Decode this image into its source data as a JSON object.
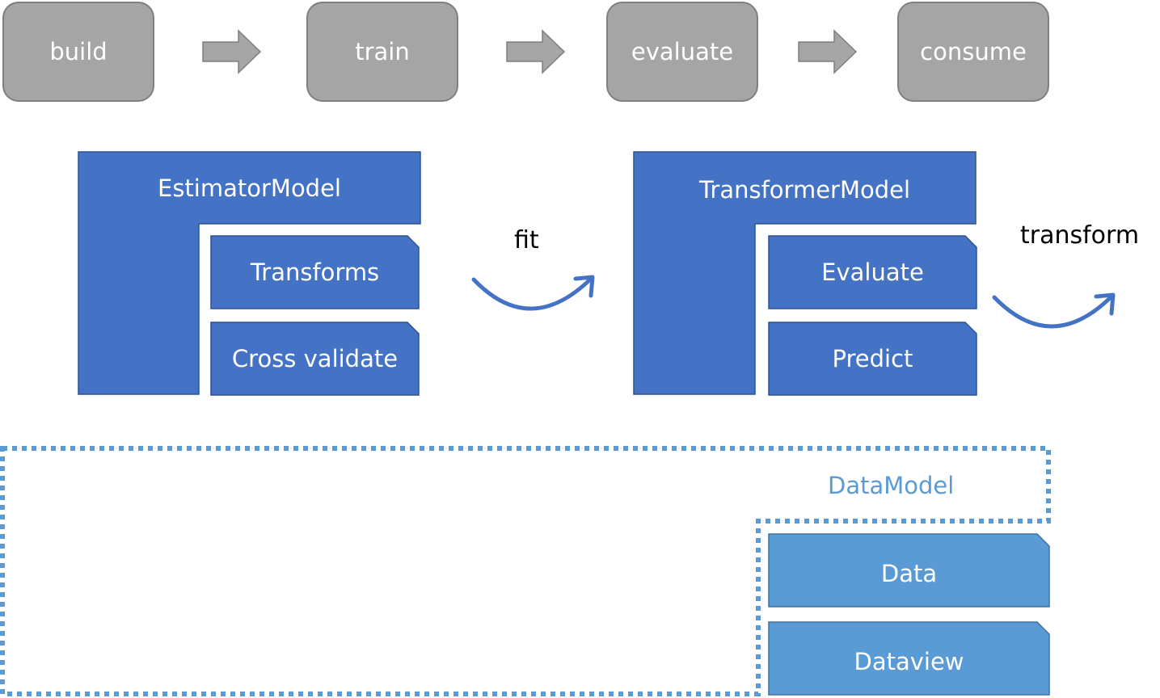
{
  "pipeline": {
    "stages": [
      "build",
      "train",
      "evaluate",
      "consume"
    ]
  },
  "estimator": {
    "title": "EstimatorModel",
    "components": [
      "Transforms",
      "Cross validate"
    ]
  },
  "fit_label": "fit",
  "transformer": {
    "title": "TransformerModel",
    "components": [
      "Evaluate",
      "Predict"
    ]
  },
  "transform_label": "transform",
  "data_model": {
    "title": "DataModel",
    "components": [
      "Data",
      "Dataview"
    ]
  },
  "colors": {
    "stage_fill": "#a5a5a5",
    "stage_border": "#7f7f7f",
    "model_fill": "#4472c4",
    "model_border": "#2f528f",
    "data_fill": "#5b9bd5",
    "data_border": "#41719c",
    "dotted_border": "#5b9bd5",
    "text_light": "#ffffff",
    "text_dark": "#000000"
  }
}
